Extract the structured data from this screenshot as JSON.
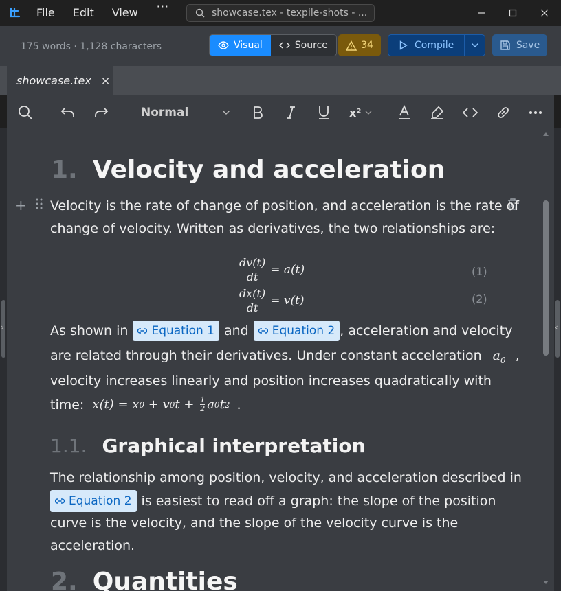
{
  "window": {
    "menu": [
      "File",
      "Edit",
      "View"
    ],
    "menu_more": "···",
    "search_text": "showcase.tex - texpile-shots - ..."
  },
  "toolbar": {
    "word_count": "175 words · 1,128 characters",
    "visual_label": "Visual",
    "source_label": "Source",
    "warning_count": "34",
    "compile_label": "Compile",
    "save_label": "Save",
    "active_mode": "Visual"
  },
  "tab": {
    "label": "showcase.tex",
    "close": "×"
  },
  "format": {
    "style": "Normal",
    "superscript": "x²"
  },
  "document": {
    "h1_num": "1.",
    "h1_title": "Velocity and acceleration",
    "p1_line1": "Velocity is the rate of change of position, and acceleration is the rate of",
    "p1_line2": "change of velocity. Written as derivatives, the two relationships are:",
    "eq1_num": "(1)",
    "eq2_num": "(2)",
    "eq1": {
      "num": "dv(t)",
      "den": "dt",
      "rhs": "= a(t)"
    },
    "eq2": {
      "num": "dx(t)",
      "den": "dt",
      "rhs": "= v(t)"
    },
    "p2_a": "As shown in",
    "p2_ref1": "Equation 1",
    "p2_b": "and",
    "p2_ref2": "Equation 2",
    "p2_c": ", acceleration and velocity",
    "p2_line2": "are related through their derivatives. Under constant acceleration",
    "p2_a0": "a",
    "p2_a0_sub": "0",
    "p2_comma": ",",
    "p2_line3": "velocity increases linearly and position increases quadratically with",
    "p2_time": "time:",
    "p2_formula_lhs": "x(t) = x",
    "p2_formula_sub0": "0",
    "p2_formula_mid": " + v",
    "p2_formula_sub1": "0",
    "p2_formula_t": "t + ",
    "p2_formula_half_num": "1",
    "p2_formula_half_den": "2",
    "p2_formula_a": "a",
    "p2_formula_sub2": "0",
    "p2_formula_t2": "t",
    "p2_formula_sup": "2",
    "p2_end": ".",
    "h2_num": "1.1.",
    "h2_title": "Graphical interpretation",
    "p3_line1": "The relationship among position, velocity, and acceleration described in",
    "p3_ref": "Equation 2",
    "p3_line2": "is easiest to read off a graph: the slope of the position",
    "p3_line3": "curve is the velocity, and the slope of the velocity curve is the",
    "p3_line4": "acceleration.",
    "h1b_num": "2.",
    "h1b_title": "Quantities"
  },
  "colors": {
    "accent": "#1a8cff",
    "warning": "#7a5a0c",
    "compile": "#0b3e7a",
    "chip_bg": "#d6e9fa",
    "chip_text": "#0a66c2"
  }
}
